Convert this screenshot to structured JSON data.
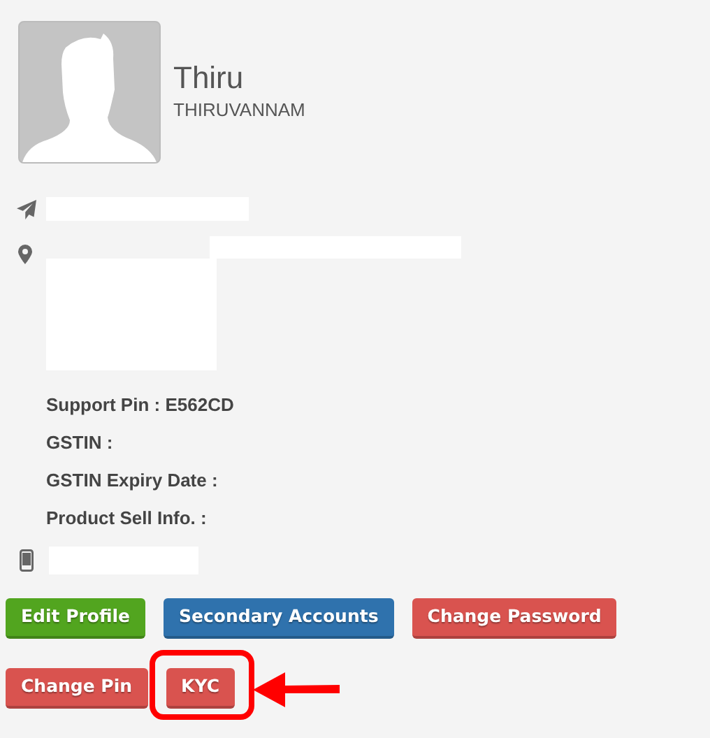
{
  "profile": {
    "name": "Thiru",
    "city": "THIRUVANNAM"
  },
  "info": [
    {
      "label": "Support Pin : E562CD"
    },
    {
      "label": "GSTIN :"
    },
    {
      "label": "GSTIN Expiry Date :"
    },
    {
      "label": "Product Sell Info. :"
    }
  ],
  "buttons": [
    [
      {
        "label": "Edit Profile",
        "color": "#52a51f",
        "highlighted": false
      },
      {
        "label": "Secondary Accounts",
        "color": "#2f72ad",
        "highlighted": false
      },
      {
        "label": "Change Password",
        "color": "#d9534f",
        "highlighted": false
      }
    ],
    [
      {
        "label": "Change Pin",
        "color": "#d9534f",
        "highlighted": false
      },
      {
        "label": "KYC",
        "color": "#d9534f",
        "highlighted": true
      }
    ]
  ]
}
